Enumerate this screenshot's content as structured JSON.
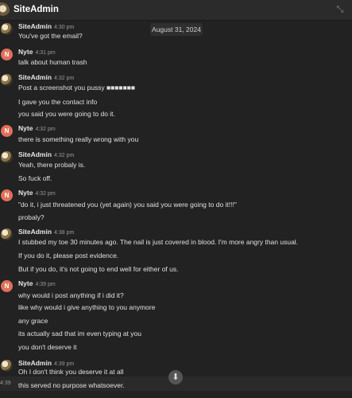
{
  "header": {
    "title": "SiteAdmin",
    "collapse_icon": "collapse-arrows-icon"
  },
  "date_divider": "August 31, 2024",
  "groups": [
    {
      "author": "SiteAdmin",
      "time": "4:30 pm",
      "lines": [
        "You've got the email?"
      ]
    },
    {
      "author": "Nyte",
      "avatar_letter": "N",
      "time": "4:31 pm",
      "lines": [
        "talk about human trash"
      ]
    },
    {
      "author": "SiteAdmin",
      "time": "4:32 pm",
      "lines": [
        "Post a screenshot you pussy ■■■■■■■",
        "I gave you the contact info",
        "you said you were going to do it."
      ]
    },
    {
      "author": "Nyte",
      "avatar_letter": "N",
      "time": "4:32 pm",
      "lines": [
        "there is something really wrong with you"
      ]
    },
    {
      "author": "SiteAdmin",
      "time": "4:32 pm",
      "lines": [
        "Yeah, there probaly is.",
        "So fuck off."
      ]
    },
    {
      "author": "Nyte",
      "avatar_letter": "N",
      "time": "4:32 pm",
      "lines": [
        "\"do it, i just threatened you (yet again) you said you were going to do it!!!\"",
        "probaly?"
      ]
    },
    {
      "author": "SiteAdmin",
      "time": "4:38 pm",
      "lines": [
        "I stubbed my toe 30 minutes ago. The nail is just covered in blood. I'm more angry than usual.",
        "If you do it, please post evidence.",
        "But if you do, it's not going to end well for either of us."
      ]
    },
    {
      "author": "Nyte",
      "avatar_letter": "N",
      "time": "4:39 pm",
      "lines": [
        "why would i post anything if i did it?",
        "like why would i give anything to you anymore",
        "any grace",
        "its actually sad that im even typing at you",
        "you don't deserve it"
      ]
    },
    {
      "author": "SiteAdmin",
      "time": "4:39 pm",
      "lines": [
        "Oh I don't think you deserve it at all",
        "this served no purpose whatsoever."
      ]
    }
  ],
  "hover_time": "4:39",
  "scroll_button_icon": "arrow-down-icon",
  "colors": {
    "background": "#222222",
    "nyte_avatar": "#e0705a"
  }
}
